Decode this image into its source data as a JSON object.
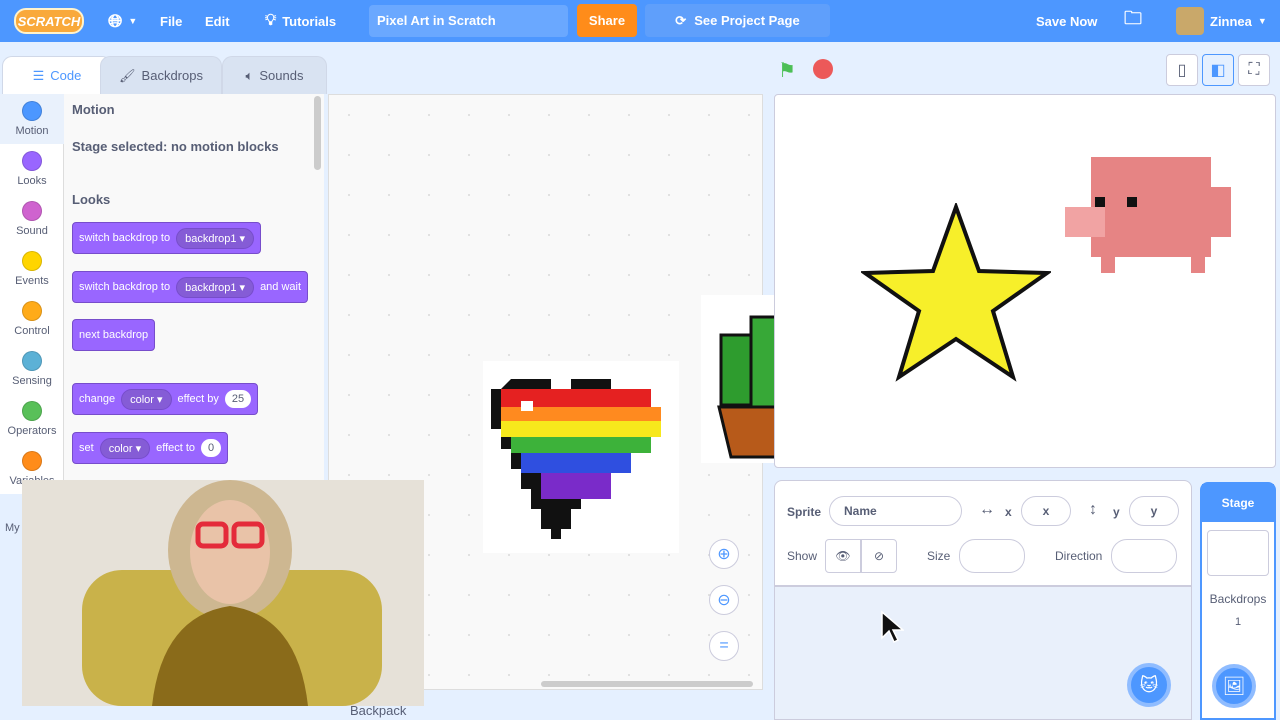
{
  "menubar": {
    "logo": "SCRATCH",
    "globe_icon": "globe-icon",
    "file": "File",
    "edit": "Edit",
    "tutorials": "Tutorials",
    "project_title": "Pixel Art in Scratch",
    "share": "Share",
    "see_project_page": "See Project Page",
    "save_now": "Save Now",
    "username": "Zinnea"
  },
  "tabs": [
    {
      "label": "Code"
    },
    {
      "label": "Backdrops"
    },
    {
      "label": "Sounds"
    }
  ],
  "categories": [
    {
      "label": "Motion",
      "color": "#4c97ff"
    },
    {
      "label": "Looks",
      "color": "#9966ff"
    },
    {
      "label": "Sound",
      "color": "#cf63cf"
    },
    {
      "label": "Events",
      "color": "#ffd500"
    },
    {
      "label": "Control",
      "color": "#ffab19"
    },
    {
      "label": "Sensing",
      "color": "#5cb1d6"
    },
    {
      "label": "Operators",
      "color": "#59c059"
    },
    {
      "label": "Variables",
      "color": "#ff8c1a"
    }
  ],
  "my_blocks_partial": "My",
  "palette": {
    "motion_heading": "Motion",
    "motion_note": "Stage selected: no motion blocks",
    "looks_heading": "Looks",
    "blocks": [
      {
        "text": "switch backdrop to",
        "dropdown": "backdrop1"
      },
      {
        "text": "switch backdrop to",
        "dropdown": "backdrop1",
        "suffix": "and wait"
      },
      {
        "text": "next backdrop"
      },
      {
        "text": "change",
        "dropdown": "color",
        "mid": "effect by",
        "value": "25"
      },
      {
        "text": "set",
        "dropdown": "color",
        "mid": "effect to",
        "value": "0"
      }
    ]
  },
  "backpack": "Backpack",
  "sprite_info": {
    "sprite_label": "Sprite",
    "name_placeholder": "Name",
    "x_label": "x",
    "x_placeholder": "x",
    "y_label": "y",
    "y_placeholder": "y",
    "show_label": "Show",
    "size_label": "Size",
    "direction_label": "Direction"
  },
  "stage_panel": {
    "title": "Stage",
    "backdrops_label": "Backdrops",
    "backdrops_count": "1"
  },
  "colors": {
    "accent": "#4d97ff",
    "share": "#ff8c1a",
    "looks": "#9966ff"
  }
}
